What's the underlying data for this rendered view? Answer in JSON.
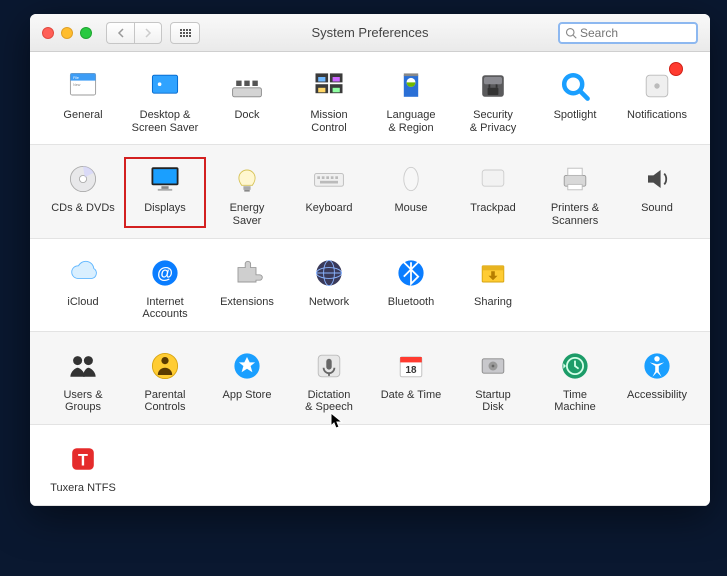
{
  "window": {
    "title": "System Preferences",
    "search_placeholder": "Search"
  },
  "row1": [
    {
      "name": "general",
      "label": "General"
    },
    {
      "name": "desktop-screensaver",
      "label": "Desktop &\nScreen Saver"
    },
    {
      "name": "dock",
      "label": "Dock"
    },
    {
      "name": "mission-control",
      "label": "Mission\nControl"
    },
    {
      "name": "language-region",
      "label": "Language\n& Region"
    },
    {
      "name": "security-privacy",
      "label": "Security\n& Privacy"
    },
    {
      "name": "spotlight",
      "label": "Spotlight"
    },
    {
      "name": "notifications",
      "label": "Notifications",
      "badge": true
    }
  ],
  "row2": [
    {
      "name": "cds-dvds",
      "label": "CDs & DVDs"
    },
    {
      "name": "displays",
      "label": "Displays",
      "highlighted": true
    },
    {
      "name": "energy-saver",
      "label": "Energy\nSaver"
    },
    {
      "name": "keyboard",
      "label": "Keyboard"
    },
    {
      "name": "mouse",
      "label": "Mouse"
    },
    {
      "name": "trackpad",
      "label": "Trackpad"
    },
    {
      "name": "printers-scanners",
      "label": "Printers &\nScanners"
    },
    {
      "name": "sound",
      "label": "Sound"
    }
  ],
  "row3": [
    {
      "name": "icloud",
      "label": "iCloud"
    },
    {
      "name": "internet-accounts",
      "label": "Internet\nAccounts"
    },
    {
      "name": "extensions",
      "label": "Extensions"
    },
    {
      "name": "network",
      "label": "Network"
    },
    {
      "name": "bluetooth",
      "label": "Bluetooth"
    },
    {
      "name": "sharing",
      "label": "Sharing"
    }
  ],
  "row4": [
    {
      "name": "users-groups",
      "label": "Users &\nGroups"
    },
    {
      "name": "parental-controls",
      "label": "Parental\nControls"
    },
    {
      "name": "app-store",
      "label": "App Store"
    },
    {
      "name": "dictation-speech",
      "label": "Dictation\n& Speech"
    },
    {
      "name": "date-time",
      "label": "Date & Time"
    },
    {
      "name": "startup-disk",
      "label": "Startup\nDisk"
    },
    {
      "name": "time-machine",
      "label": "Time\nMachine"
    },
    {
      "name": "accessibility",
      "label": "Accessibility"
    }
  ],
  "row5": [
    {
      "name": "tuxera-ntfs",
      "label": "Tuxera NTFS"
    }
  ]
}
